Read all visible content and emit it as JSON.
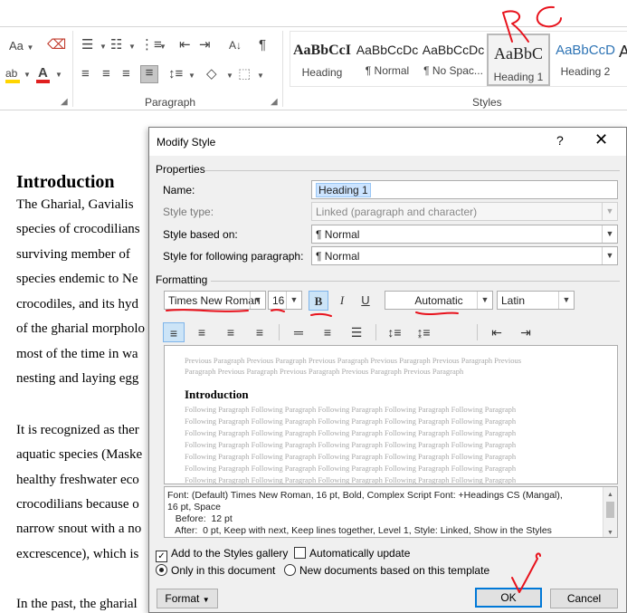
{
  "ribbon": {
    "font_size_grow": "Aa",
    "paragraph_group_label": "Paragraph",
    "styles_group_label": "Styles",
    "sort_icon": "sort-az-icon",
    "pilcrow": "¶",
    "styles": [
      {
        "sample": "AaBbCcI",
        "name": "Heading"
      },
      {
        "sample": "AaBbCcDc",
        "name": "¶ Normal"
      },
      {
        "sample": "AaBbCcDc",
        "name": "¶ No Spac..."
      },
      {
        "sample": "AaBbC",
        "name": "Heading 1"
      },
      {
        "sample": "AaBbCcD",
        "name": "Heading 2"
      },
      {
        "sample": "A",
        "name": ""
      }
    ]
  },
  "document": {
    "heading": "Introduction",
    "lines": [
      "The Gharial, Gavialis",
      "species of crocodilians",
      "surviving member of",
      "species endemic to Ne",
      "crocodiles, and its hyd",
      "of the gharial morpholo",
      "most of the time in wa",
      "nesting and laying egg",
      "It is recognized as ther",
      "aquatic species (Maske",
      "healthy freshwater eco",
      "crocodilians because o",
      "narrow snout with a no",
      "excrescence), which is",
      "In the past, the gharial"
    ]
  },
  "dialog": {
    "title": "Modify Style",
    "help": "?",
    "close": "✕",
    "properties_label": "Properties",
    "name_label": "Name:",
    "name_value": "Heading 1",
    "style_type_label": "Style type:",
    "style_type_value": "Linked (paragraph and character)",
    "based_on_label": "Style based on:",
    "based_on_value": "¶  Normal",
    "following_label": "Style for following paragraph:",
    "following_value": "¶  Normal",
    "formatting_label": "Formatting",
    "font": "Times New Roman",
    "size": "16",
    "bold": "B",
    "italic": "I",
    "underline": "U",
    "color": "Automatic",
    "script": "Latin",
    "preview": {
      "previous_1": "Previous Paragraph Previous Paragraph Previous Paragraph Previous Paragraph Previous Paragraph Previous",
      "previous_2": "Paragraph Previous Paragraph Previous Paragraph Previous Paragraph Previous Paragraph",
      "heading": "Introduction",
      "following": "Following Paragraph Following Paragraph Following Paragraph Following Paragraph Following Paragraph"
    },
    "description": {
      "line1": "Font: (Default) Times New Roman, 16 pt, Bold, Complex Script Font: +Headings CS (Mangal),",
      "line2": "16 pt, Space",
      "line3": "   Before:  12 pt",
      "line4": "   After:  0 pt, Keep with next, Keep lines together, Level 1, Style: Linked, Show in the Styles"
    },
    "add_to_gallery": "Add to the Styles gallery",
    "auto_update": "Automatically update",
    "only_this_doc": "Only in this document",
    "new_docs": "New documents based on this template",
    "format_button": "Format",
    "ok_button": "OK",
    "cancel_button": "Cancel"
  },
  "colors": {
    "annotation_red": "#e8121c",
    "highlight_yellow": "#ffd500",
    "font_red": "#e02020",
    "ok_border": "#0078d7"
  }
}
